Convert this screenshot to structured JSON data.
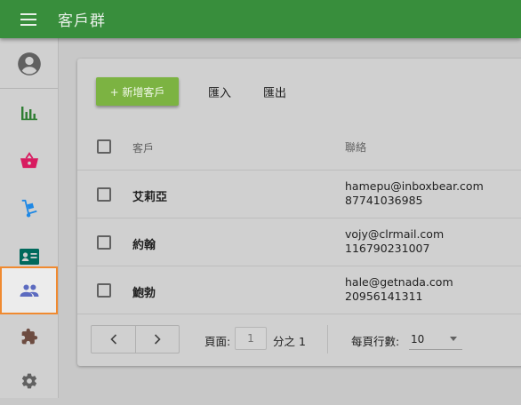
{
  "appbar": {
    "title": "客戶群"
  },
  "sidebar": {
    "items": [
      {
        "name": "account",
        "icon": "account-circle-icon",
        "active": false
      },
      {
        "name": "dashboard",
        "icon": "bar-chart-icon",
        "active": false
      },
      {
        "name": "orders",
        "icon": "shopping-basket-icon",
        "active": false
      },
      {
        "name": "products",
        "icon": "hand-truck-icon",
        "active": false
      },
      {
        "name": "contacts",
        "icon": "contact-card-icon",
        "active": false
      },
      {
        "name": "customers",
        "icon": "people-icon",
        "active": true
      },
      {
        "name": "extensions",
        "icon": "puzzle-icon",
        "active": false
      },
      {
        "name": "settings",
        "icon": "gear-icon",
        "active": false
      }
    ]
  },
  "toolbar": {
    "new_label": "+ 新增客戶",
    "import_label": "匯入",
    "export_label": "匯出"
  },
  "table": {
    "headers": {
      "name": "客戶",
      "contact": "聯絡"
    },
    "rows": [
      {
        "name": "艾莉亞",
        "email": "hamepu@inboxbear.com",
        "phone": "87741036985"
      },
      {
        "name": "約翰",
        "email": "vojy@clrmail.com",
        "phone": "116790231007"
      },
      {
        "name": "鮑勃",
        "email": "hale@getnada.com",
        "phone": "20956141311"
      }
    ]
  },
  "pager": {
    "page_label": "頁面:",
    "page_value": "1",
    "page_of": "分之 1",
    "rows_label": "每頁行數:",
    "rows_value": "10"
  },
  "colors": {
    "appbar": "#388e3c",
    "new_button": "#7cb342",
    "active_outline": "#f08a30",
    "icon_green": "#2e7d32",
    "icon_pink": "#d81b60",
    "icon_blue": "#1e88e5",
    "icon_teal": "#00695c",
    "icon_indigo": "#5c6bc0",
    "icon_brown": "#6d4c41",
    "icon_grey": "#616161"
  }
}
